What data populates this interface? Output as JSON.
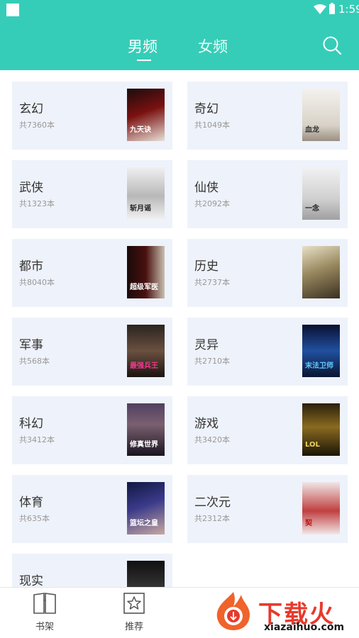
{
  "status_bar": {
    "time": "1:59"
  },
  "header": {
    "tabs": [
      {
        "label": "男频",
        "active": true
      },
      {
        "label": "女频",
        "active": false
      }
    ],
    "search_icon": "search-icon",
    "accent_color": "#36cdb8"
  },
  "categories": [
    {
      "name": "玄幻",
      "count": "共7360本",
      "cover_text": "九天诀",
      "cover_color": "#7a1010"
    },
    {
      "name": "奇幻",
      "count": "共1049本",
      "cover_text": "血龙",
      "cover_color": "#e9e5dd"
    },
    {
      "name": "武侠",
      "count": "共1323本",
      "cover_text": "斩月谣",
      "cover_color": "#dcdcdc"
    },
    {
      "name": "仙侠",
      "count": "共2092本",
      "cover_text": "一念",
      "cover_color": "#e6e6e6"
    },
    {
      "name": "都市",
      "count": "共8040本",
      "cover_text": "超级军医",
      "cover_color": "#2a1010"
    },
    {
      "name": "历史",
      "count": "共2737本",
      "cover_text": "",
      "cover_color": "#8a8060"
    },
    {
      "name": "军事",
      "count": "共568本",
      "cover_text": "最强兵王",
      "cover_color": "#3a2a1a"
    },
    {
      "name": "灵异",
      "count": "共2710本",
      "cover_text": "末法卫师",
      "cover_color": "#0a1a40"
    },
    {
      "name": "科幻",
      "count": "共3412本",
      "cover_text": "修真世界",
      "cover_color": "#3a2030"
    },
    {
      "name": "游戏",
      "count": "共3420本",
      "cover_text": "LOL",
      "cover_color": "#3a2a10"
    },
    {
      "name": "体育",
      "count": "共635本",
      "cover_text": "篮坛之皇",
      "cover_color": "#1a1a3a"
    },
    {
      "name": "二次元",
      "count": "共2312本",
      "cover_text": "契",
      "cover_color": "#e8dada"
    },
    {
      "name": "现实",
      "count": "",
      "cover_text": "",
      "cover_color": "#1a1a1a"
    }
  ],
  "bottom_nav": [
    {
      "label": "书架",
      "icon": "book-icon"
    },
    {
      "label": "推荐",
      "icon": "star-icon"
    }
  ],
  "watermark": {
    "title": "下载火",
    "url": "xiazaihuo.com"
  }
}
